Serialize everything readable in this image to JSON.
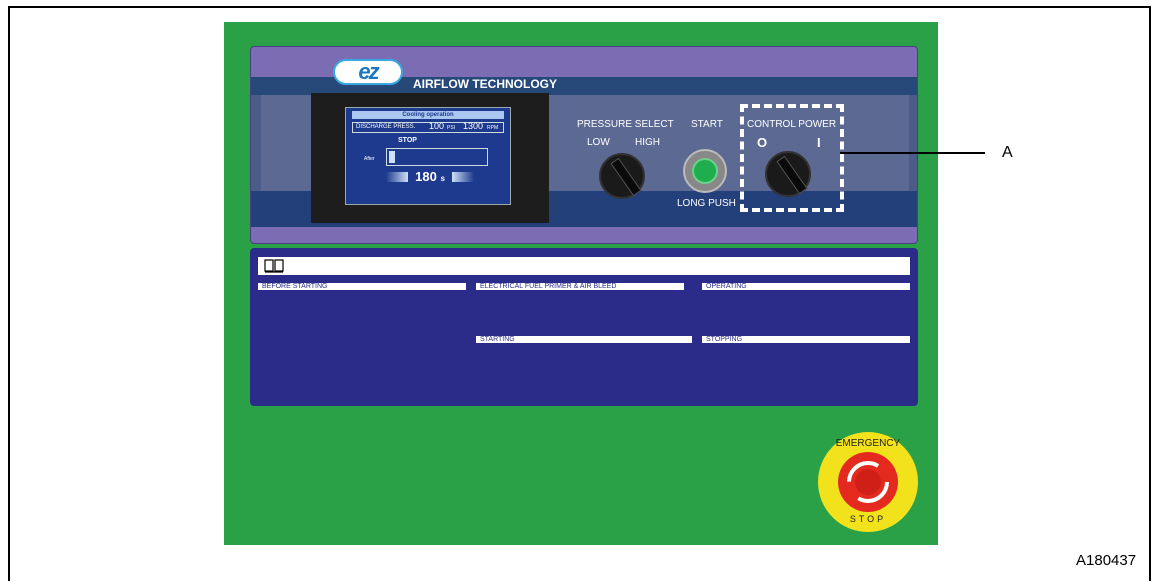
{
  "panel": {
    "brand_logo": "ez",
    "brand_name": "AIRFLOW TECHNOLOGY",
    "display": {
      "title": "Cooling operation",
      "discharge_label": "DISCHARGE PRESS.",
      "pressure_value": "100",
      "pressure_unit": "PSI",
      "rpm_value": "1300",
      "rpm_unit": "RPM",
      "status": "STOP",
      "after_label": "After",
      "timer_value": "180",
      "timer_unit": "s"
    },
    "pressure_select": {
      "label": "PRESSURE SELECT",
      "low": "LOW",
      "high": "HIGH"
    },
    "start": {
      "label": "START",
      "sub_label": "LONG PUSH"
    },
    "control_power": {
      "label": "CONTROL POWER",
      "off": "O",
      "on": "I"
    },
    "tabs": [
      "BEFORE STARTING",
      "ELECTRICAL FUEL PRIMER & AIR BLEED",
      "OPERATING",
      "STARTING",
      "STOPPING"
    ],
    "emergency": {
      "top": "EMERGENCY",
      "bottom": "STOP"
    }
  },
  "callout": {
    "label": "A"
  },
  "figure_id": "A180437",
  "colors": {
    "panel_green": "#2aa146",
    "panel_purple": "#7b6cb4",
    "lower_panel_blue": "#2b2c89",
    "start_green": "#1fae4d",
    "estop_yellow": "#f2e21c",
    "estop_red": "#e42a1f"
  }
}
